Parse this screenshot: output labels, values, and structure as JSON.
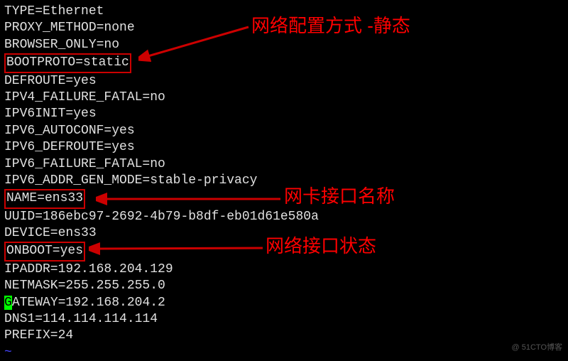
{
  "lines": {
    "type": "TYPE=Ethernet",
    "proxy_method": "PROXY_METHOD=none",
    "browser_only": "BROWSER_ONLY=no",
    "bootproto": "BOOTPROTO=static",
    "defroute": "DEFROUTE=yes",
    "ipv4_failure": "IPV4_FAILURE_FATAL=no",
    "ipv6init": "IPV6INIT=yes",
    "ipv6_autoconf": "IPV6_AUTOCONF=yes",
    "ipv6_defroute": "IPV6_DEFROUTE=yes",
    "ipv6_failure": "IPV6_FAILURE_FATAL=no",
    "ipv6_addr_gen": "IPV6_ADDR_GEN_MODE=stable-privacy",
    "name": "NAME=ens33",
    "uuid": "UUID=186ebc97-2692-4b79-b8df-eb01d61e580a",
    "device": "DEVICE=ens33",
    "onboot": "ONBOOT=yes",
    "ipaddr": "IPADDR=192.168.204.129",
    "netmask": "NETMASK=255.255.255.0",
    "gateway_g": "G",
    "gateway_rest": "ATEWAY=192.168.204.2",
    "dns1": "DNS1=114.114.114.114",
    "prefix": "PREFIX=24",
    "tilde": "~"
  },
  "annotations": {
    "bootproto": "网络配置方式 -静态",
    "name": "网卡接口名称",
    "onboot": "网络接口状态"
  },
  "watermark": "@ 51CTO博客"
}
